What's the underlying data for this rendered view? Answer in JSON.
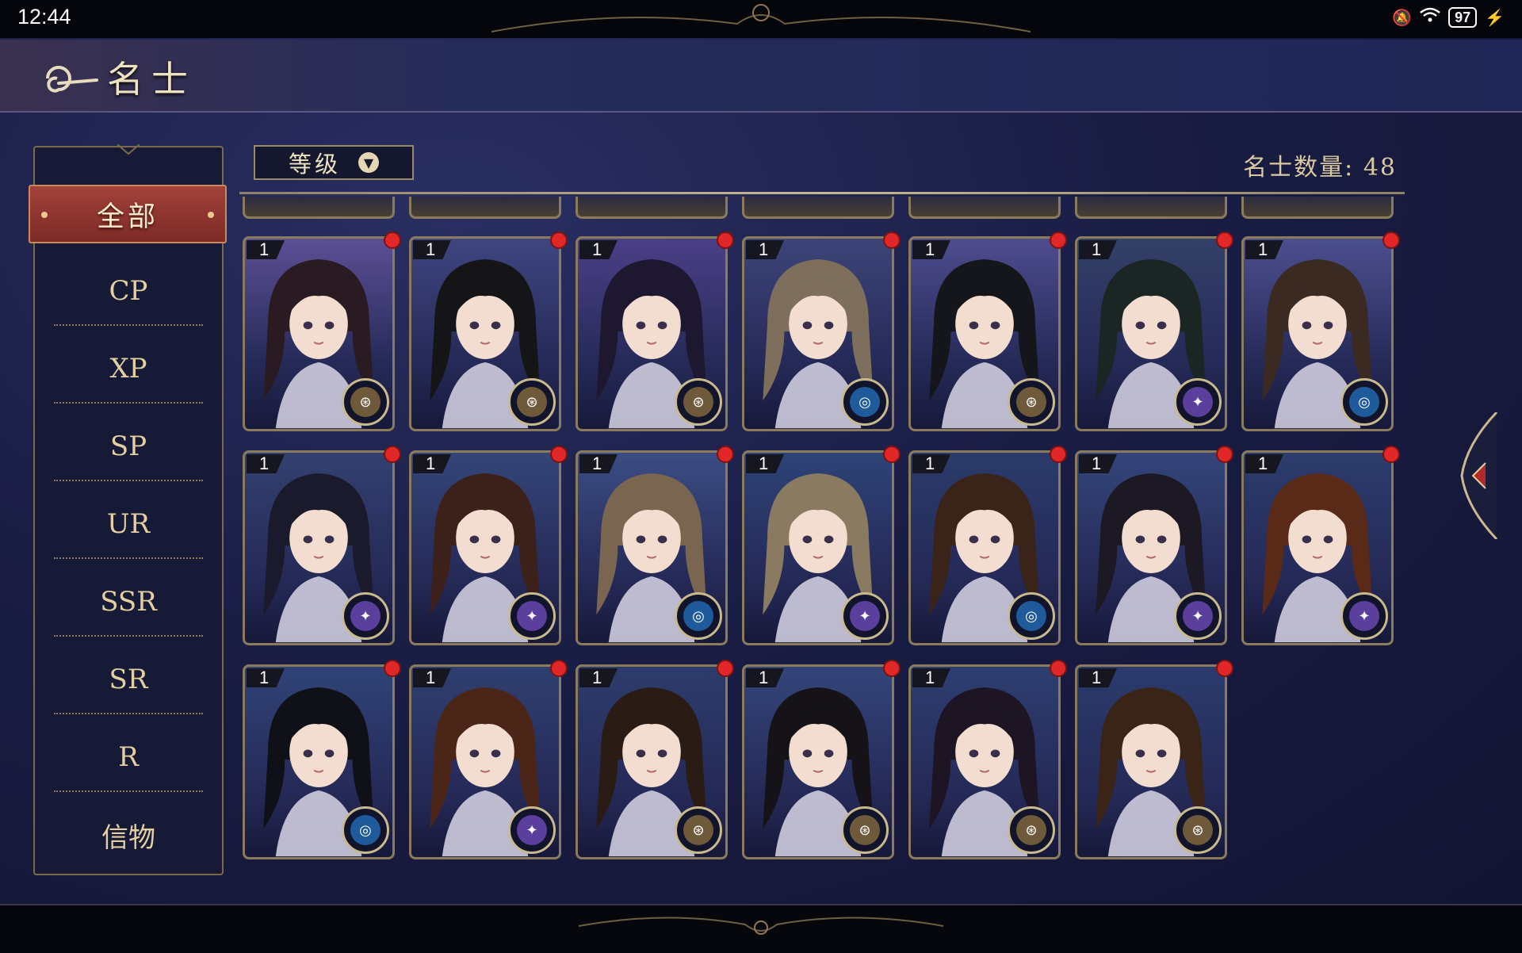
{
  "status_bar": {
    "time": "12:44",
    "battery": "97"
  },
  "page_title": "名士",
  "sidebar": {
    "items": [
      {
        "label": "全部",
        "active": true
      },
      {
        "label": "CP"
      },
      {
        "label": "XP"
      },
      {
        "label": "SP"
      },
      {
        "label": "UR"
      },
      {
        "label": "SSR"
      },
      {
        "label": "SR"
      },
      {
        "label": "R"
      },
      {
        "label": "信物"
      }
    ]
  },
  "sort": {
    "label": "等级"
  },
  "hero_count_label": "名士数量: 48",
  "cards": [
    {
      "level": "1",
      "badge": "gold-emblem",
      "hue": "#5c4f95",
      "hair": "#2a1a22",
      "notify": true
    },
    {
      "level": "1",
      "badge": "gold-emblem",
      "hue": "#3f4580",
      "hair": "#151518",
      "notify": true
    },
    {
      "level": "1",
      "badge": "gold-emblem",
      "hue": "#4b3f88",
      "hair": "#1e1730",
      "notify": true
    },
    {
      "level": "1",
      "badge": "blue-emblem",
      "hue": "#3d4478",
      "hair": "#7d6f5c",
      "notify": true
    },
    {
      "level": "1",
      "badge": "gold-emblem",
      "hue": "#4e4c8f",
      "hair": "#15161c",
      "notify": true
    },
    {
      "level": "1",
      "badge": "purple-emblem",
      "hue": "#334068",
      "hair": "#1b2524",
      "notify": true
    },
    {
      "level": "1",
      "badge": "blue-emblem",
      "hue": "#4c4f8e",
      "hair": "#3a2a22",
      "notify": true
    },
    {
      "level": "1",
      "badge": "purple-emblem",
      "hue": "#33406f",
      "hair": "#1b1a2c",
      "notify": true
    },
    {
      "level": "1",
      "badge": "purple-emblem",
      "hue": "#344578",
      "hair": "#3b211a",
      "notify": true
    },
    {
      "level": "1",
      "badge": "blue-emblem",
      "hue": "#3b4d83",
      "hair": "#7a6650",
      "notify": true
    },
    {
      "level": "1",
      "badge": "purple-emblem",
      "hue": "#2e4377",
      "hair": "#8a7a62",
      "notify": true
    },
    {
      "level": "1",
      "badge": "blue-emblem",
      "hue": "#2b3b6a",
      "hair": "#3a2318",
      "notify": true
    },
    {
      "level": "1",
      "badge": "purple-emblem",
      "hue": "#34457a",
      "hair": "#1c1824",
      "notify": true
    },
    {
      "level": "1",
      "badge": "purple-emblem",
      "hue": "#2c3c6c",
      "hair": "#5a2a18",
      "notify": true
    },
    {
      "level": "1",
      "badge": "blue-emblem",
      "hue": "#304377",
      "hair": "#101018",
      "notify": true
    },
    {
      "level": "1",
      "badge": "purple-emblem",
      "hue": "#2f3f70",
      "hair": "#4b2618",
      "notify": true
    },
    {
      "level": "1",
      "badge": "gold-emblem",
      "hue": "#2d3c6c",
      "hair": "#2a1c14",
      "notify": true
    },
    {
      "level": "1",
      "badge": "gold-emblem",
      "hue": "#34457a",
      "hair": "#151318",
      "notify": true
    },
    {
      "level": "1",
      "badge": "gold-emblem",
      "hue": "#2e3e70",
      "hair": "#1d1524",
      "notify": true
    },
    {
      "level": "1",
      "badge": "gold-emblem",
      "hue": "#2b3b6c",
      "hair": "#3a2418",
      "notify": true
    }
  ],
  "badge_colors": {
    "gold-emblem": "#6e5a3a",
    "blue-emblem": "#1f5b9a",
    "purple-emblem": "#5a3f9c"
  }
}
